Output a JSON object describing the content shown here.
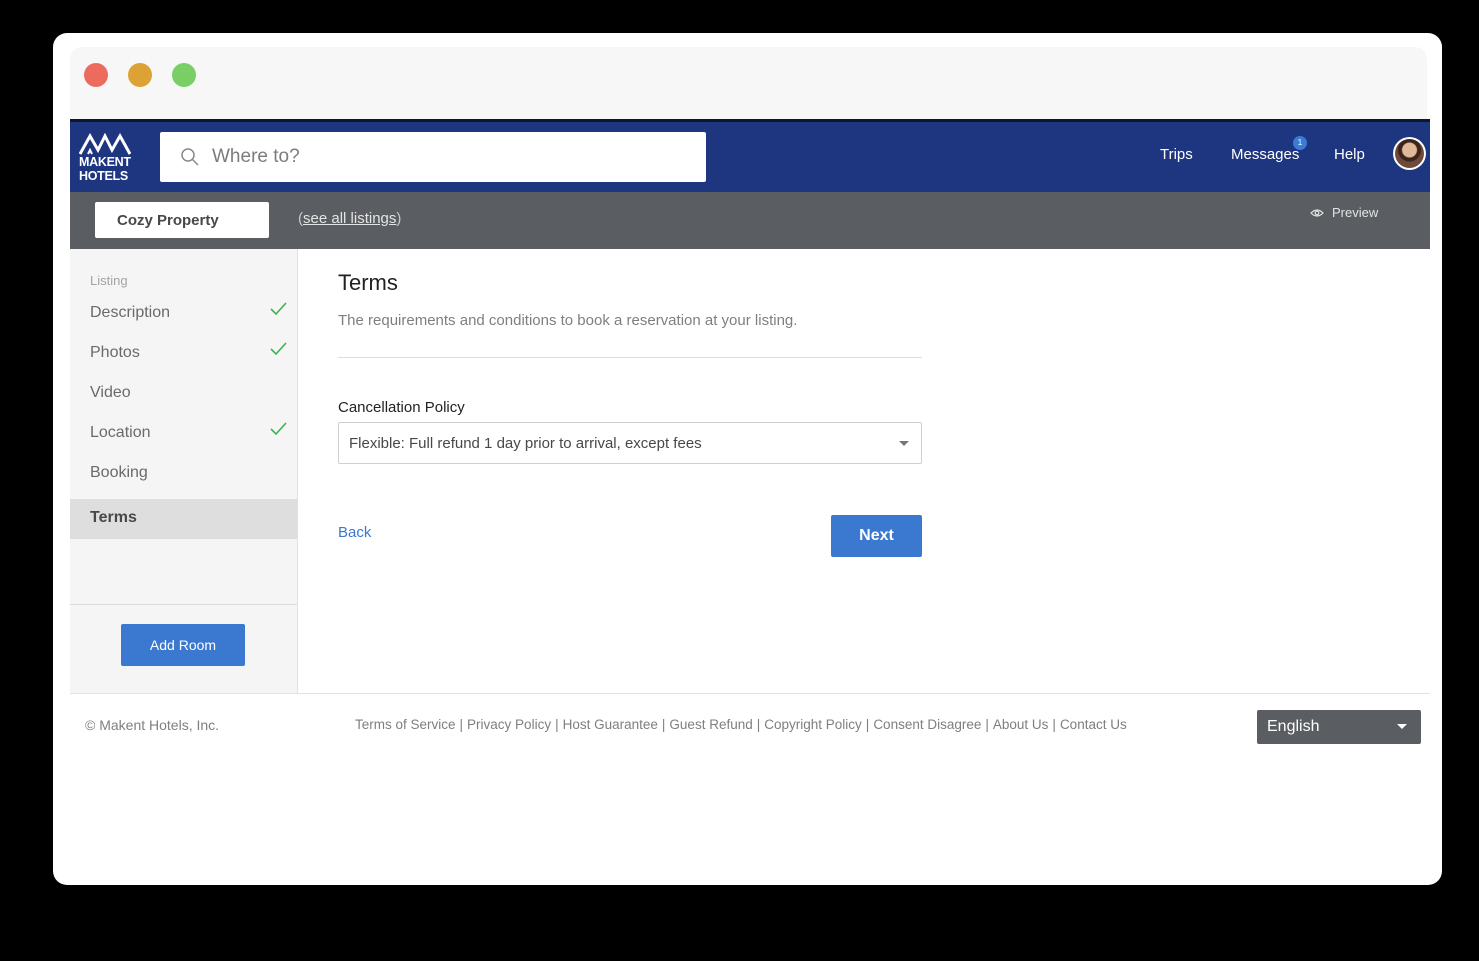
{
  "brand": {
    "name_line1": "MAKENT",
    "name_line2": "HOTELS"
  },
  "search": {
    "placeholder": "Where to?"
  },
  "nav": {
    "trips": "Trips",
    "messages": "Messages",
    "messages_badge": "1",
    "help": "Help"
  },
  "subbar": {
    "property": "Cozy Property",
    "see_all_prefix": "(",
    "see_all": "see all listings",
    "see_all_suffix": ")",
    "preview": "Preview"
  },
  "sidebar": {
    "heading": "Listing",
    "items": [
      {
        "label": "Description",
        "checked": true
      },
      {
        "label": "Photos",
        "checked": true
      },
      {
        "label": "Video",
        "checked": false
      },
      {
        "label": "Location",
        "checked": true
      },
      {
        "label": "Booking",
        "checked": false
      },
      {
        "label": "Terms",
        "checked": false,
        "active": true
      }
    ],
    "add_room": "Add Room"
  },
  "main": {
    "title": "Terms",
    "subtitle": "The requirements and conditions to book a reservation at your listing.",
    "cancellation_label": "Cancellation Policy",
    "cancellation_value": "Flexible: Full refund 1 day prior to arrival, except fees",
    "back": "Back",
    "next": "Next"
  },
  "footer": {
    "copyright": "© Makent Hotels, Inc.",
    "links": [
      "Terms of Service",
      "Privacy Policy",
      "Host Guarantee",
      "Guest Refund",
      "Copyright Policy",
      "Consent Disagree",
      "About Us",
      "Contact Us"
    ],
    "language": "English"
  },
  "colors": {
    "header": "#1e3580",
    "accent": "#3a79cf",
    "check": "#3cb44b",
    "subbar": "#5a5d61"
  }
}
